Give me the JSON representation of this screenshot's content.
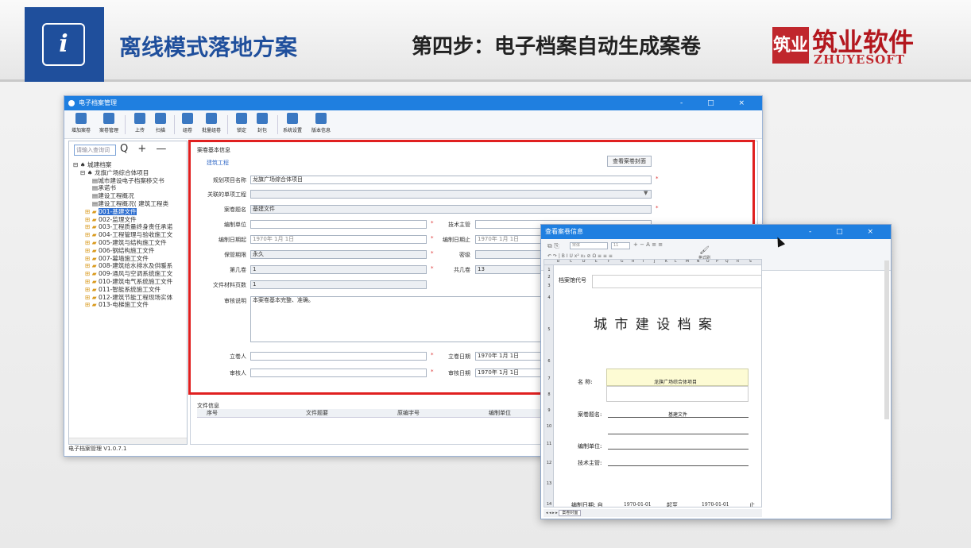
{
  "slide": {
    "title": "离线模式落地方案",
    "step": "第四步：电子档案自动生成案卷",
    "logo_icon": "info-icon",
    "brand_mark": "筑业",
    "brand_cn": "筑业软件",
    "brand_en": "ZHUYESOFT"
  },
  "app": {
    "title": "电子档案管理",
    "window_controls": "- □ ×",
    "toolbar": [
      "增加案卷",
      "案卷管理",
      "上传",
      "扫描",
      "组卷",
      "批量组卷",
      "锁定",
      "封包",
      "系统设置",
      "版本信息"
    ],
    "search_placeholder": "请输入查询词",
    "tree_tools": "Q + —",
    "tree": [
      {
        "label": "城建档案",
        "indent": 0,
        "prefix": "⊟ ♠"
      },
      {
        "label": "龙旗广场综合体项目",
        "indent": 1,
        "prefix": "⊟ ♠"
      },
      {
        "label": "城市建设电子档案移交书",
        "indent": 2,
        "prefix": "▤"
      },
      {
        "label": "承诺书",
        "indent": 2,
        "prefix": "▤"
      },
      {
        "label": "建设工程概况",
        "indent": 2,
        "prefix": "▤"
      },
      {
        "label": "建设工程概况( 建筑工程类",
        "indent": 2,
        "prefix": "▤"
      },
      {
        "label": "001-基建文件",
        "indent": 1,
        "prefix": "⊞ ▰",
        "selected": true
      },
      {
        "label": "002-监理文件",
        "indent": 1,
        "prefix": "⊞ ▰"
      },
      {
        "label": "003-工程质量终身责任承诺",
        "indent": 1,
        "prefix": "⊞ ▰"
      },
      {
        "label": "004-工程管理与验收施工文",
        "indent": 1,
        "prefix": "⊞ ▰"
      },
      {
        "label": "005-建筑与结构施工文件",
        "indent": 1,
        "prefix": "⊞ ▰"
      },
      {
        "label": "006-钢结构施工文件",
        "indent": 1,
        "prefix": "⊞ ▰"
      },
      {
        "label": "007-幕墙施工文件",
        "indent": 1,
        "prefix": "⊞ ▰"
      },
      {
        "label": "008-建筑给水排水及供暖系",
        "indent": 1,
        "prefix": "⊞ ▰"
      },
      {
        "label": "009-通风与空调系统施工文",
        "indent": 1,
        "prefix": "⊞ ▰"
      },
      {
        "label": "010-建筑电气系统施工文件",
        "indent": 1,
        "prefix": "⊞ ▰"
      },
      {
        "label": "011-智能系统施工文件",
        "indent": 1,
        "prefix": "⊞ ▰"
      },
      {
        "label": "012-建筑节能工程现场实体",
        "indent": 1,
        "prefix": "⊞ ▰"
      },
      {
        "label": "013-电梯施工文件",
        "indent": 1,
        "prefix": "⊞ ▰"
      }
    ],
    "status": "电子档案管理  V1.0.7.1",
    "form": {
      "section_title": "案卷基本信息",
      "category": "建筑工程",
      "view_cover_btn": "查看案卷封面",
      "project_label": "规划项目名称",
      "project_value": "龙旗广场综合体项目",
      "unit_project_label": "关联的单项工程",
      "unit_project_value": "",
      "title_label": "案卷题名",
      "title_value": "基建文件",
      "compiler_label": "编制单位",
      "compiler_value": "",
      "tech_label": "技术主管",
      "tech_value": "",
      "start_label": "编制日期起",
      "start_value": "1970年 1月 1日",
      "end_label": "编制日期止",
      "end_value": "1970年 1月 1日",
      "retention_label": "保管期限",
      "retention_value": "永久",
      "secret_label": "密级",
      "secret_value": "",
      "volume_label": "第几卷",
      "volume_value": "1",
      "total_label": "共几卷",
      "total_value": "13",
      "pages_label": "文件材料页数",
      "pages_value": "1",
      "remark_label": "审核说明",
      "remark_value": "本案卷基本完整、准确。",
      "creator_label": "立卷人",
      "creator_value": "",
      "create_date_label": "立卷日期",
      "create_date_value": "1970年 1月 1日",
      "reviewer_label": "审核人",
      "reviewer_value": "",
      "review_date_label": "审核日期",
      "review_date_value": "1970年 1月 1日",
      "required_mark": "*"
    },
    "files": {
      "section_title": "文件信息",
      "columns": [
        "序号",
        "文件题要",
        "原编字号",
        "编制单位"
      ]
    }
  },
  "viewer": {
    "title": "查看案卷信息",
    "font_name": "宋体",
    "font_size": "11",
    "format_painter": "格式刷",
    "columns": [
      "B",
      "C",
      "D",
      "E",
      "F",
      "G",
      "H",
      "I",
      "J",
      "K",
      "L",
      "M",
      "N",
      "O",
      "P",
      "Q",
      "R",
      "S"
    ],
    "rows": [
      "1",
      "2",
      "3",
      "4",
      "5",
      "6",
      "7",
      "8",
      "9",
      "10",
      "11",
      "12",
      "13",
      "14"
    ],
    "archive_no_label": "档案馆代号",
    "doc_title": "城 市 建 设 档 案",
    "name_label": "名    称:",
    "name_value": "龙旗广场综合体项目",
    "case_title_label": "案卷题名:",
    "case_title_value": "基建文件",
    "compiler_label": "编制单位:",
    "tech_label": "技术主管:",
    "date_label": "编制日期: 自",
    "date_from": "1970-01-01",
    "date_mid": "起至",
    "date_to": "1970-01-01",
    "date_end": "止",
    "sheet_tab": "案卷封面"
  }
}
